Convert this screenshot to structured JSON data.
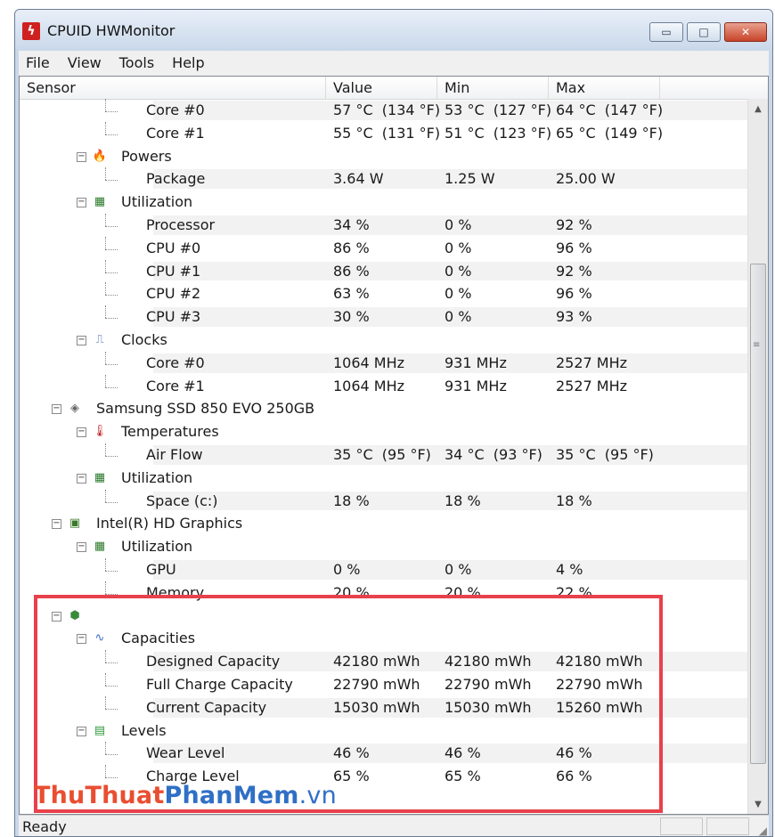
{
  "window": {
    "title": "CPUID HWMonitor",
    "buttons": {
      "minimize": "▭",
      "maximize": "□",
      "close": "✕"
    }
  },
  "menu": [
    "File",
    "View",
    "Tools",
    "Help"
  ],
  "columns": [
    "Sensor",
    "Value",
    "Min",
    "Max"
  ],
  "rows": [
    {
      "level": 3,
      "label": "Core #0",
      "value": "57 °C  (134 °F)",
      "min": "53 °C  (127 °F)",
      "max": "64 °C  (147 °F)",
      "shaded": true
    },
    {
      "level": 3,
      "label": "Core #1",
      "value": "55 °C  (131 °F)",
      "min": "51 °C  (123 °F)",
      "max": "65 °C  (149 °F)",
      "shaded": false
    },
    {
      "level": 2,
      "label": "Powers",
      "icon": "flame-icon",
      "shaded": false
    },
    {
      "level": 3,
      "label": "Package",
      "value": "3.64 W",
      "min": "1.25 W",
      "max": "25.00 W",
      "shaded": true
    },
    {
      "level": 2,
      "label": "Utilization",
      "icon": "chart-icon",
      "shaded": false
    },
    {
      "level": 3,
      "label": "Processor",
      "value": "34 %",
      "min": "0 %",
      "max": "92 %",
      "shaded": true
    },
    {
      "level": 3,
      "label": "CPU #0",
      "value": "86 %",
      "min": "0 %",
      "max": "96 %",
      "shaded": false
    },
    {
      "level": 3,
      "label": "CPU #1",
      "value": "86 %",
      "min": "0 %",
      "max": "92 %",
      "shaded": true
    },
    {
      "level": 3,
      "label": "CPU #2",
      "value": "63 %",
      "min": "0 %",
      "max": "96 %",
      "shaded": false
    },
    {
      "level": 3,
      "label": "CPU #3",
      "value": "30 %",
      "min": "0 %",
      "max": "93 %",
      "shaded": true
    },
    {
      "level": 2,
      "label": "Clocks",
      "icon": "clock-wave-icon",
      "shaded": false
    },
    {
      "level": 3,
      "label": "Core #0",
      "value": "1064 MHz",
      "min": "931 MHz",
      "max": "2527 MHz",
      "shaded": true
    },
    {
      "level": 3,
      "label": "Core #1",
      "value": "1064 MHz",
      "min": "931 MHz",
      "max": "2527 MHz",
      "shaded": false
    },
    {
      "level": 1,
      "label": "Samsung SSD 850 EVO 250GB",
      "icon": "disk-icon",
      "shaded": false
    },
    {
      "level": 2,
      "label": "Temperatures",
      "icon": "thermometer-icon",
      "shaded": false
    },
    {
      "level": 3,
      "label": "Air Flow",
      "value": "35 °C  (95 °F)",
      "min": "34 °C  (93 °F)",
      "max": "35 °C  (95 °F)",
      "shaded": true
    },
    {
      "level": 2,
      "label": "Utilization",
      "icon": "chart-icon",
      "shaded": false
    },
    {
      "level": 3,
      "label": "Space (c:)",
      "value": "18 %",
      "min": "18 %",
      "max": "18 %",
      "shaded": true
    },
    {
      "level": 1,
      "label": "Intel(R) HD Graphics",
      "icon": "gpu-icon",
      "shaded": false
    },
    {
      "level": 2,
      "label": "Utilization",
      "icon": "chart-icon",
      "shaded": false
    },
    {
      "level": 3,
      "label": "GPU",
      "value": "0 %",
      "min": "0 %",
      "max": "4 %",
      "shaded": true
    },
    {
      "level": 3,
      "label": "Memory",
      "value": "20 %",
      "min": "20 %",
      "max": "22 %",
      "shaded": false
    },
    {
      "level": 1,
      "label": "",
      "icon": "battery-icon",
      "shaded": false
    },
    {
      "level": 2,
      "label": "Capacities",
      "icon": "capacity-icon",
      "shaded": false
    },
    {
      "level": 3,
      "label": "Designed Capacity",
      "value": "42180 mWh",
      "min": "42180 mWh",
      "max": "42180 mWh",
      "shaded": true
    },
    {
      "level": 3,
      "label": "Full Charge Capacity",
      "value": "22790 mWh",
      "min": "22790 mWh",
      "max": "22790 mWh",
      "shaded": false
    },
    {
      "level": 3,
      "label": "Current Capacity",
      "value": "15030 mWh",
      "min": "15030 mWh",
      "max": "15260 mWh",
      "shaded": true
    },
    {
      "level": 2,
      "label": "Levels",
      "icon": "levels-icon",
      "shaded": false
    },
    {
      "level": 3,
      "label": "Wear Level",
      "value": "46 %",
      "min": "46 %",
      "max": "46 %",
      "shaded": true
    },
    {
      "level": 3,
      "label": "Charge Level",
      "value": "65 %",
      "min": "65 %",
      "max": "66 %",
      "shaded": false
    }
  ],
  "status": "Ready",
  "watermark": {
    "part1": "ThuThuat",
    "part2": "PhanMem",
    "part3": ".vn"
  },
  "colors": {
    "highlight": "#e8414b",
    "row_shade": "#f2f2f2"
  }
}
